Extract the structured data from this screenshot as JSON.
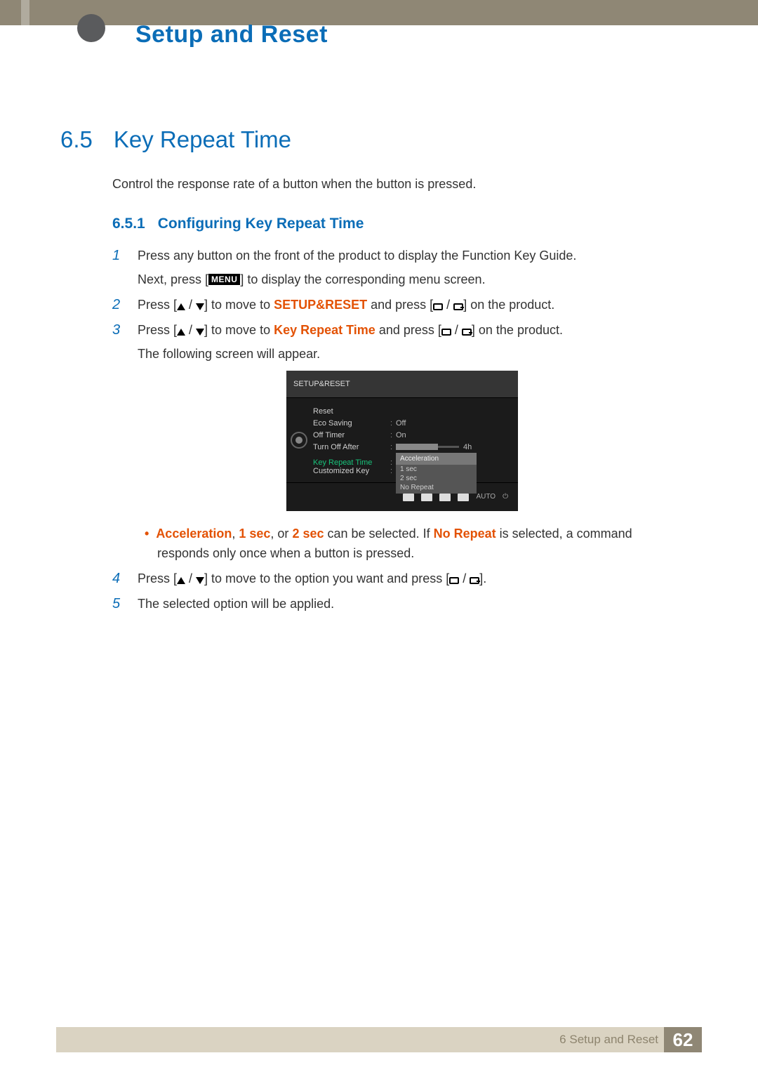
{
  "chapter_title": "Setup and Reset",
  "section": {
    "num": "6.5",
    "title": "Key Repeat Time"
  },
  "intro": "Control the response rate of a button when the button is pressed.",
  "subsection": {
    "num": "6.5.1",
    "title": "Configuring Key Repeat Time"
  },
  "steps": {
    "s1a": "Press any button on the front of the product to display the Function Key Guide.",
    "s1b_pre": "Next, press [",
    "s1b_menu": "MENU",
    "s1b_post": "] to display the corresponding menu screen.",
    "s2_pre": "Press [",
    "s2_mid": "] to move to ",
    "s2_target": "SETUP&RESET",
    "s2_post1": " and press [",
    "s2_post2": "] on the product.",
    "s3_pre": "Press [",
    "s3_mid": "] to move to ",
    "s3_target": "Key Repeat Time",
    "s3_post1": " and press [",
    "s3_post2": "] on the product.",
    "s3_tail": "The following screen will appear.",
    "bullet_a": "Acceleration",
    "bullet_b": "1 sec",
    "bullet_c": "2 sec",
    "bullet_mid1": ", ",
    "bullet_mid2": ", or ",
    "bullet_mid3": " can be selected. If ",
    "bullet_d": "No Repeat",
    "bullet_tail": " is selected, a command responds only once when a button is pressed.",
    "s4_pre": "Press [",
    "s4_mid": "] to move to the option you want and press [",
    "s4_post": "].",
    "s5": "The selected option will be applied."
  },
  "osd": {
    "title": "SETUP&RESET",
    "rows": {
      "reset": "Reset",
      "eco": "Eco Saving",
      "eco_v": "Off",
      "off": "Off Timer",
      "off_v": "On",
      "turn": "Turn Off After",
      "turn_v": "4h",
      "krt": "Key Repeat Time",
      "ck": "Customized Key"
    },
    "dropdown": [
      "Acceleration",
      "1 sec",
      "2 sec",
      "No Repeat"
    ],
    "auto": "AUTO"
  },
  "footer": {
    "text": "6 Setup and Reset",
    "page": "62"
  }
}
